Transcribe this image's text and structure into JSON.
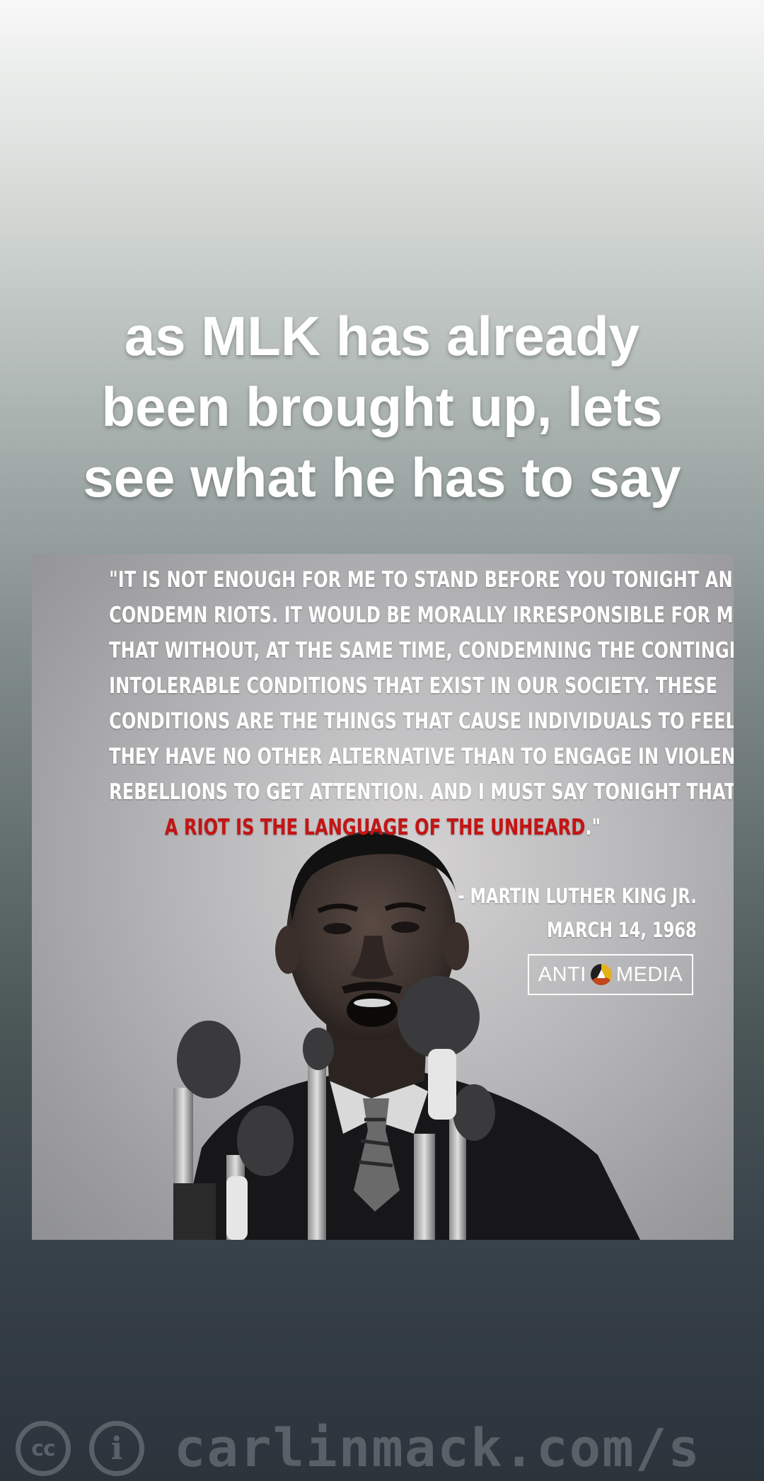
{
  "caption": {
    "line1": "as MLK has already",
    "line2": "been brought up, lets",
    "line3": "see what he has to say"
  },
  "quote_card": {
    "quote_lines": [
      "\"IT IS NOT ENOUGH FOR ME TO STAND BEFORE YOU TONIGHT AND",
      "CONDEMN RIOTS. IT WOULD BE MORALLY IRRESPONSIBLE FOR ME TO DO",
      "THAT WITHOUT, AT THE SAME TIME, CONDEMNING THE CONTINGENT,",
      "INTOLERABLE CONDITIONS THAT EXIST IN OUR SOCIETY. THESE",
      "CONDITIONS ARE THE THINGS THAT CAUSE INDIVIDUALS TO FEEL THAT",
      "THEY HAVE NO OTHER ALTERNATIVE THAN TO ENGAGE IN VIOLENT",
      "REBELLIONS TO GET ATTENTION. AND I MUST SAY TONIGHT THAT"
    ],
    "quote_highlight": "A RIOT IS THE LANGUAGE OF THE UNHEARD",
    "quote_end": ".\"",
    "author": "- MARTIN LUTHER KING JR.",
    "date": "MARCH 14, 1968",
    "logo_left": "ANTI",
    "logo_right": "MEDIA",
    "colors": {
      "highlight": "#c41414",
      "text": "#ffffff"
    }
  },
  "watermark": {
    "cc_icon": "cc-icon",
    "cc_label": "cc",
    "info_icon": "attribution-icon",
    "info_label": "i",
    "text": "carlinmack.com/s"
  }
}
